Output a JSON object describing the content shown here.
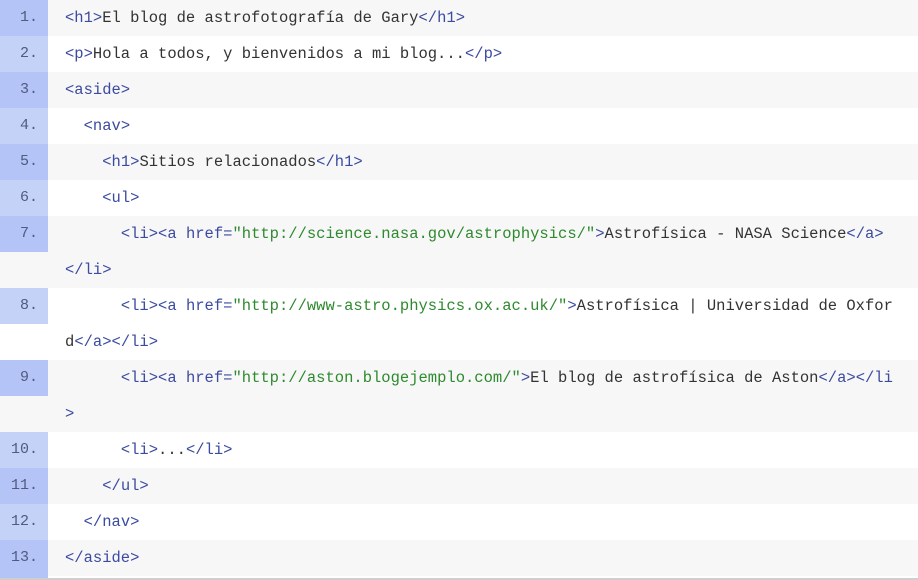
{
  "lines": [
    {
      "n": "1.",
      "indent": "",
      "parts": [
        [
          "tag",
          "<h1>"
        ],
        [
          "txt",
          "El blog de astrofotografía de Gary"
        ],
        [
          "tag",
          "</h1>"
        ]
      ]
    },
    {
      "n": "2.",
      "indent": "",
      "parts": [
        [
          "tag",
          "<p>"
        ],
        [
          "txt",
          "Hola a todos, y bienvenidos a mi blog..."
        ],
        [
          "tag",
          "</p>"
        ]
      ]
    },
    {
      "n": "3.",
      "indent": "",
      "parts": [
        [
          "tag",
          "<aside>"
        ]
      ]
    },
    {
      "n": "4.",
      "indent": "  ",
      "parts": [
        [
          "tag",
          "<nav>"
        ]
      ]
    },
    {
      "n": "5.",
      "indent": "    ",
      "parts": [
        [
          "tag",
          "<h1>"
        ],
        [
          "txt",
          "Sitios relacionados"
        ],
        [
          "tag",
          "</h1>"
        ]
      ]
    },
    {
      "n": "6.",
      "indent": "    ",
      "parts": [
        [
          "tag",
          "<ul>"
        ]
      ]
    },
    {
      "n": "7.",
      "indent": "      ",
      "parts": [
        [
          "tag",
          "<li><a "
        ],
        [
          "attr",
          "href"
        ],
        [
          "tag",
          "="
        ],
        [
          "str",
          "\"http://science.nasa.gov/astrophysics/\""
        ],
        [
          "tag",
          ">"
        ],
        [
          "txt",
          "Astrofísica - NASA Science"
        ],
        [
          "tag",
          "</a></li>"
        ]
      ]
    },
    {
      "n": "8.",
      "indent": "      ",
      "parts": [
        [
          "tag",
          "<li><a "
        ],
        [
          "attr",
          "href"
        ],
        [
          "tag",
          "="
        ],
        [
          "str",
          "\"http://www-astro.physics.ox.ac.uk/\""
        ],
        [
          "tag",
          ">"
        ],
        [
          "txt",
          "Astrofísica | Universidad de Oxford"
        ],
        [
          "tag",
          "</a></li>"
        ]
      ]
    },
    {
      "n": "9.",
      "indent": "      ",
      "parts": [
        [
          "tag",
          "<li><a "
        ],
        [
          "attr",
          "href"
        ],
        [
          "tag",
          "="
        ],
        [
          "str",
          "\"http://aston.blogejemplo.com/\""
        ],
        [
          "tag",
          ">"
        ],
        [
          "txt",
          "El blog de astrofísica de Aston"
        ],
        [
          "tag",
          "</a></li>"
        ]
      ]
    },
    {
      "n": "10.",
      "indent": "      ",
      "parts": [
        [
          "tag",
          "<li>"
        ],
        [
          "txt",
          "..."
        ],
        [
          "tag",
          "</li>"
        ]
      ]
    },
    {
      "n": "11.",
      "indent": "    ",
      "parts": [
        [
          "tag",
          "</ul>"
        ]
      ]
    },
    {
      "n": "12.",
      "indent": "  ",
      "parts": [
        [
          "tag",
          "</nav>"
        ]
      ]
    },
    {
      "n": "13.",
      "indent": "",
      "parts": [
        [
          "tag",
          "</aside>"
        ]
      ]
    }
  ]
}
